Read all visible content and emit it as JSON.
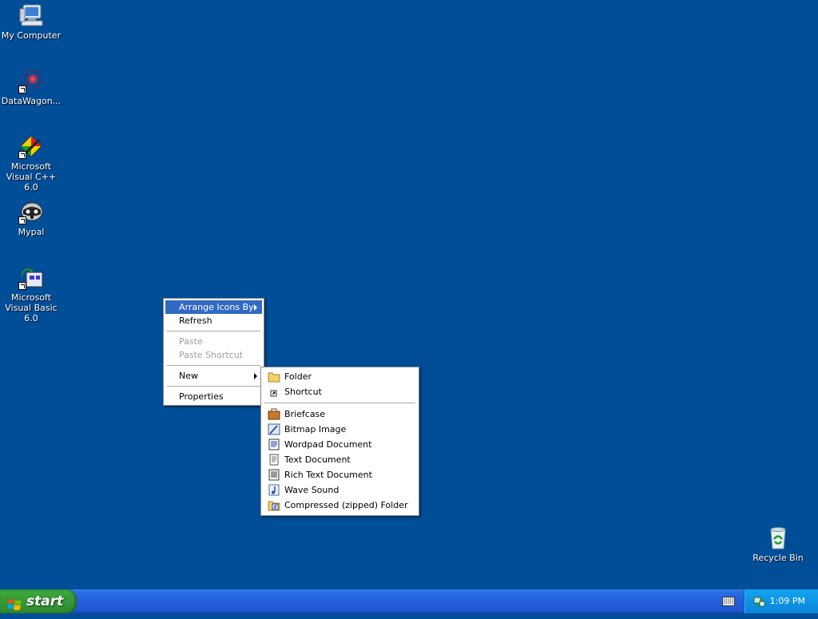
{
  "desktop": {
    "background": "#004e98",
    "icons": [
      {
        "label": "My Computer",
        "icon": "my-computer-icon"
      },
      {
        "label": "DataWagon...",
        "icon": "datawagon-icon"
      },
      {
        "label": "Microsoft Visual C++ 6.0",
        "icon": "visual-cpp-icon"
      },
      {
        "label": "Mypal",
        "icon": "mypal-icon"
      },
      {
        "label": "Microsoft Visual Basic 6.0",
        "icon": "visual-basic-icon"
      },
      {
        "label": "Recycle Bin",
        "icon": "recycle-bin-icon"
      }
    ]
  },
  "context_menu": {
    "items": [
      {
        "label": "Arrange Icons By",
        "submenu": true,
        "selected": true
      },
      {
        "label": "Refresh"
      },
      {
        "label": "Paste",
        "disabled": true
      },
      {
        "label": "Paste Shortcut",
        "disabled": true
      },
      {
        "label": "New",
        "submenu": true
      },
      {
        "label": "Properties"
      }
    ]
  },
  "new_submenu": {
    "items": [
      {
        "label": "Folder",
        "icon": "folder-icon"
      },
      {
        "label": "Shortcut",
        "icon": "shortcut-icon"
      },
      {
        "label": "Briefcase",
        "icon": "briefcase-icon"
      },
      {
        "label": "Bitmap Image",
        "icon": "bitmap-icon"
      },
      {
        "label": "Wordpad Document",
        "icon": "wordpad-icon"
      },
      {
        "label": "Text Document",
        "icon": "text-document-icon"
      },
      {
        "label": "Rich Text Document",
        "icon": "rich-text-icon"
      },
      {
        "label": "Wave Sound",
        "icon": "wave-sound-icon"
      },
      {
        "label": "Compressed (zipped) Folder",
        "icon": "zip-folder-icon"
      }
    ]
  },
  "taskbar": {
    "start_label": "start",
    "clock": "1:09 PM"
  },
  "colors": {
    "menu_highlight": "#316ac5",
    "taskbar": "#245edb",
    "start_button": "#379a37",
    "tray": "#0f93e6"
  }
}
